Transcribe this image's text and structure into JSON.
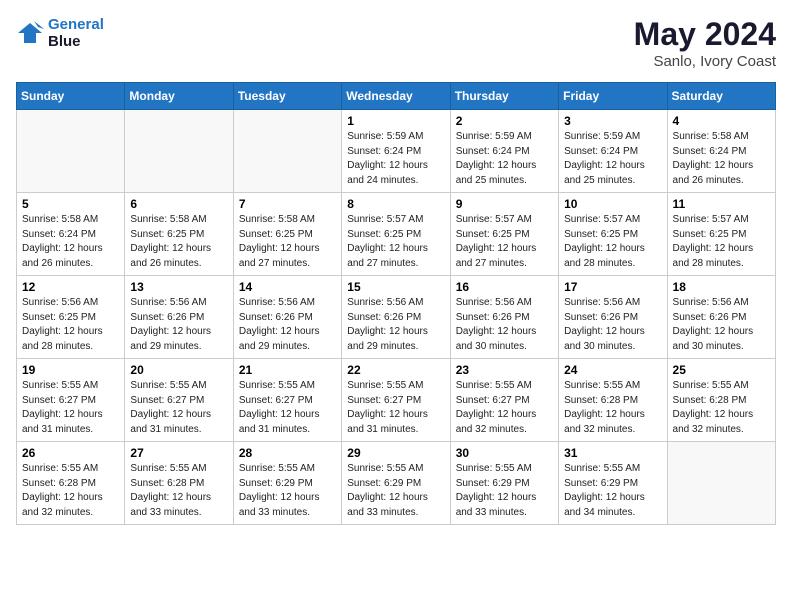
{
  "header": {
    "logo_line1": "General",
    "logo_line2": "Blue",
    "month": "May 2024",
    "location": "Sanlo, Ivory Coast"
  },
  "days_of_week": [
    "Sunday",
    "Monday",
    "Tuesday",
    "Wednesday",
    "Thursday",
    "Friday",
    "Saturday"
  ],
  "weeks": [
    [
      {
        "day": "",
        "info": ""
      },
      {
        "day": "",
        "info": ""
      },
      {
        "day": "",
        "info": ""
      },
      {
        "day": "1",
        "info": "Sunrise: 5:59 AM\nSunset: 6:24 PM\nDaylight: 12 hours\nand 24 minutes."
      },
      {
        "day": "2",
        "info": "Sunrise: 5:59 AM\nSunset: 6:24 PM\nDaylight: 12 hours\nand 25 minutes."
      },
      {
        "day": "3",
        "info": "Sunrise: 5:59 AM\nSunset: 6:24 PM\nDaylight: 12 hours\nand 25 minutes."
      },
      {
        "day": "4",
        "info": "Sunrise: 5:58 AM\nSunset: 6:24 PM\nDaylight: 12 hours\nand 26 minutes."
      }
    ],
    [
      {
        "day": "5",
        "info": "Sunrise: 5:58 AM\nSunset: 6:24 PM\nDaylight: 12 hours\nand 26 minutes."
      },
      {
        "day": "6",
        "info": "Sunrise: 5:58 AM\nSunset: 6:25 PM\nDaylight: 12 hours\nand 26 minutes."
      },
      {
        "day": "7",
        "info": "Sunrise: 5:58 AM\nSunset: 6:25 PM\nDaylight: 12 hours\nand 27 minutes."
      },
      {
        "day": "8",
        "info": "Sunrise: 5:57 AM\nSunset: 6:25 PM\nDaylight: 12 hours\nand 27 minutes."
      },
      {
        "day": "9",
        "info": "Sunrise: 5:57 AM\nSunset: 6:25 PM\nDaylight: 12 hours\nand 27 minutes."
      },
      {
        "day": "10",
        "info": "Sunrise: 5:57 AM\nSunset: 6:25 PM\nDaylight: 12 hours\nand 28 minutes."
      },
      {
        "day": "11",
        "info": "Sunrise: 5:57 AM\nSunset: 6:25 PM\nDaylight: 12 hours\nand 28 minutes."
      }
    ],
    [
      {
        "day": "12",
        "info": "Sunrise: 5:56 AM\nSunset: 6:25 PM\nDaylight: 12 hours\nand 28 minutes."
      },
      {
        "day": "13",
        "info": "Sunrise: 5:56 AM\nSunset: 6:26 PM\nDaylight: 12 hours\nand 29 minutes."
      },
      {
        "day": "14",
        "info": "Sunrise: 5:56 AM\nSunset: 6:26 PM\nDaylight: 12 hours\nand 29 minutes."
      },
      {
        "day": "15",
        "info": "Sunrise: 5:56 AM\nSunset: 6:26 PM\nDaylight: 12 hours\nand 29 minutes."
      },
      {
        "day": "16",
        "info": "Sunrise: 5:56 AM\nSunset: 6:26 PM\nDaylight: 12 hours\nand 30 minutes."
      },
      {
        "day": "17",
        "info": "Sunrise: 5:56 AM\nSunset: 6:26 PM\nDaylight: 12 hours\nand 30 minutes."
      },
      {
        "day": "18",
        "info": "Sunrise: 5:56 AM\nSunset: 6:26 PM\nDaylight: 12 hours\nand 30 minutes."
      }
    ],
    [
      {
        "day": "19",
        "info": "Sunrise: 5:55 AM\nSunset: 6:27 PM\nDaylight: 12 hours\nand 31 minutes."
      },
      {
        "day": "20",
        "info": "Sunrise: 5:55 AM\nSunset: 6:27 PM\nDaylight: 12 hours\nand 31 minutes."
      },
      {
        "day": "21",
        "info": "Sunrise: 5:55 AM\nSunset: 6:27 PM\nDaylight: 12 hours\nand 31 minutes."
      },
      {
        "day": "22",
        "info": "Sunrise: 5:55 AM\nSunset: 6:27 PM\nDaylight: 12 hours\nand 31 minutes."
      },
      {
        "day": "23",
        "info": "Sunrise: 5:55 AM\nSunset: 6:27 PM\nDaylight: 12 hours\nand 32 minutes."
      },
      {
        "day": "24",
        "info": "Sunrise: 5:55 AM\nSunset: 6:28 PM\nDaylight: 12 hours\nand 32 minutes."
      },
      {
        "day": "25",
        "info": "Sunrise: 5:55 AM\nSunset: 6:28 PM\nDaylight: 12 hours\nand 32 minutes."
      }
    ],
    [
      {
        "day": "26",
        "info": "Sunrise: 5:55 AM\nSunset: 6:28 PM\nDaylight: 12 hours\nand 32 minutes."
      },
      {
        "day": "27",
        "info": "Sunrise: 5:55 AM\nSunset: 6:28 PM\nDaylight: 12 hours\nand 33 minutes."
      },
      {
        "day": "28",
        "info": "Sunrise: 5:55 AM\nSunset: 6:29 PM\nDaylight: 12 hours\nand 33 minutes."
      },
      {
        "day": "29",
        "info": "Sunrise: 5:55 AM\nSunset: 6:29 PM\nDaylight: 12 hours\nand 33 minutes."
      },
      {
        "day": "30",
        "info": "Sunrise: 5:55 AM\nSunset: 6:29 PM\nDaylight: 12 hours\nand 33 minutes."
      },
      {
        "day": "31",
        "info": "Sunrise: 5:55 AM\nSunset: 6:29 PM\nDaylight: 12 hours\nand 34 minutes."
      },
      {
        "day": "",
        "info": ""
      }
    ]
  ]
}
